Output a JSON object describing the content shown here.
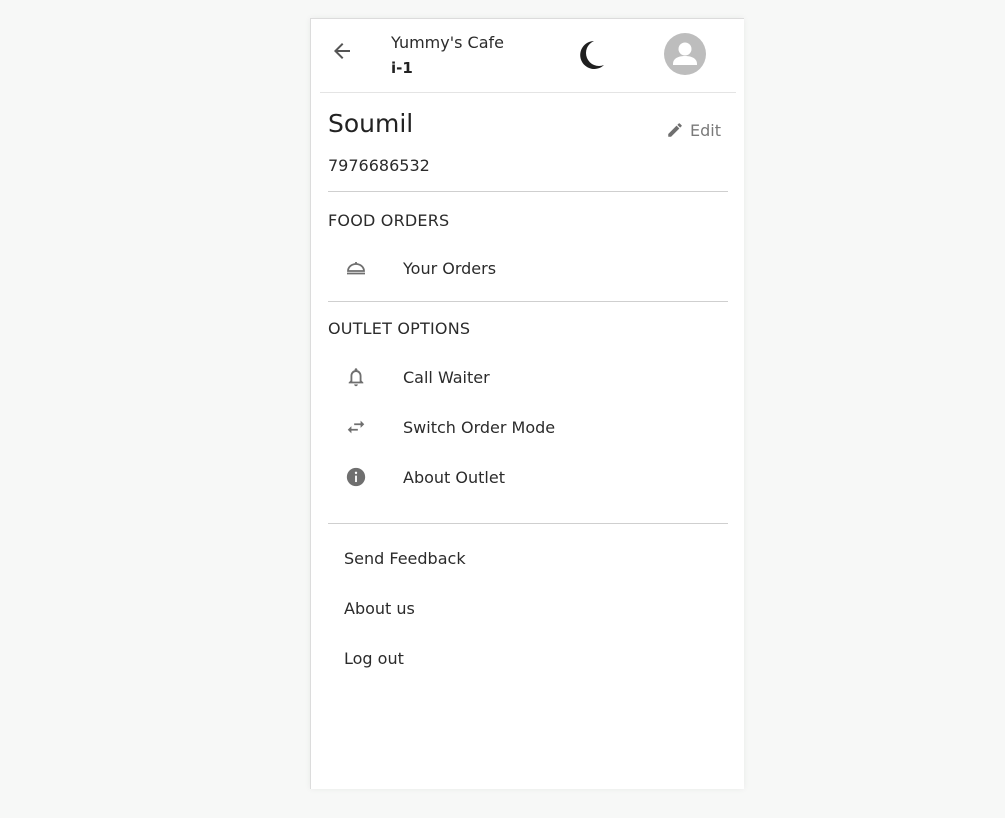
{
  "header": {
    "outlet_name": "Yummy's Cafe",
    "table_id": "i-1",
    "back_icon": "arrow-left-icon",
    "theme_icon": "moon-icon",
    "avatar_icon": "person-icon"
  },
  "profile": {
    "name": "Soumil",
    "phone": "7976686532",
    "edit_label": "Edit",
    "edit_icon": "pencil-icon"
  },
  "food_orders": {
    "title": "FOOD ORDERS",
    "items": [
      {
        "label": "Your Orders",
        "icon": "cloche-icon"
      }
    ]
  },
  "outlet_options": {
    "title": "OUTLET OPTIONS",
    "items": [
      {
        "label": "Call Waiter",
        "icon": "bell-icon"
      },
      {
        "label": "Switch Order Mode",
        "icon": "swap-arrows-icon"
      },
      {
        "label": "About Outlet",
        "icon": "info-icon"
      }
    ]
  },
  "footer_links": [
    {
      "label": "Send Feedback"
    },
    {
      "label": "About us"
    },
    {
      "label": "Log out"
    }
  ],
  "colors": {
    "icon_gray": "#6f6f6f",
    "avatar_bg": "#bdbdbd",
    "divider": "#cfcfcf",
    "text": "#2b2b2b"
  }
}
